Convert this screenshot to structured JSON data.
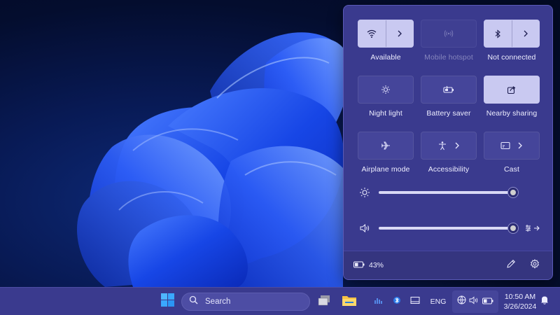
{
  "quick_settings": {
    "tiles": [
      {
        "label": "Available",
        "icon": "wifi-icon",
        "state": "on",
        "has_chevron": true
      },
      {
        "label": "Mobile hotspot",
        "icon": "hotspot-icon",
        "state": "disabled",
        "has_chevron": false
      },
      {
        "label": "Not connected",
        "icon": "bluetooth-icon",
        "state": "on",
        "has_chevron": true
      },
      {
        "label": "Night light",
        "icon": "night-light-icon",
        "state": "off",
        "has_chevron": false
      },
      {
        "label": "Battery saver",
        "icon": "battery-saver-icon",
        "state": "off",
        "has_chevron": false
      },
      {
        "label": "Nearby sharing",
        "icon": "nearby-sharing-icon",
        "state": "on",
        "has_chevron": false
      },
      {
        "label": "Airplane mode",
        "icon": "airplane-icon",
        "state": "off",
        "has_chevron": false
      },
      {
        "label": "Accessibility",
        "icon": "accessibility-icon",
        "state": "off",
        "has_chevron": true
      },
      {
        "label": "Cast",
        "icon": "cast-icon",
        "state": "off",
        "has_chevron": true
      }
    ],
    "brightness": {
      "icon": "brightness-icon",
      "level": 1.0
    },
    "volume": {
      "icon": "speaker-icon",
      "level": 1.0,
      "extra_icon": "audio-output-icon"
    },
    "footer": {
      "battery_icon": "battery-icon",
      "battery_percent": "43%",
      "edit_icon": "pencil-icon",
      "settings_icon": "gear-icon"
    }
  },
  "taskbar": {
    "start_icon": "windows-logo-icon",
    "search_placeholder": "Search",
    "pinned": [
      {
        "name": "task-view-icon"
      },
      {
        "name": "file-explorer-icon"
      }
    ],
    "tray": {
      "language": "ENG",
      "clock_time": "10:50 AM",
      "clock_date": "3/26/2024"
    }
  },
  "colors": {
    "panel_bg": "#3a3a8e",
    "tile_on": "#c9c9f1",
    "tile_off": "#45459a",
    "accent_wallpaper": "#1a4bff"
  }
}
